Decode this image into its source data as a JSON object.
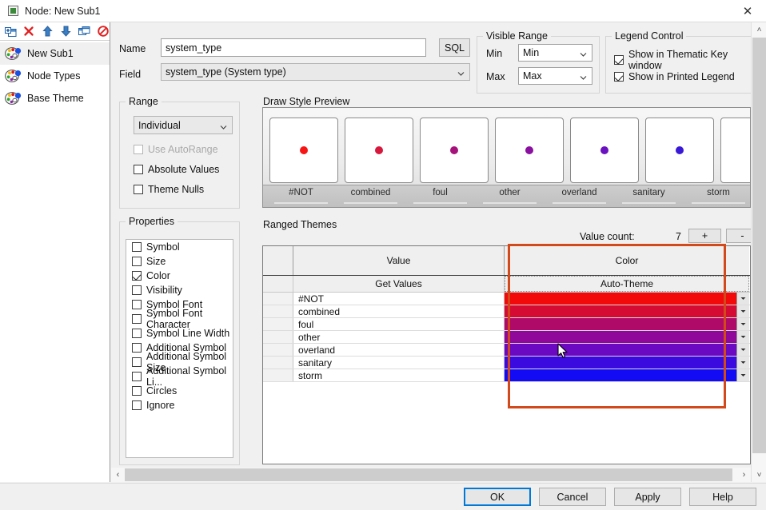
{
  "window": {
    "title": "Node: New Sub1",
    "close_label": "✕",
    "icon": "node-theme-icon"
  },
  "sidebar": {
    "toolbar": [
      {
        "name": "add-sub-theme",
        "icon": "add-window-icon"
      },
      {
        "name": "delete-theme",
        "icon": "red-x-icon"
      },
      {
        "name": "move-up",
        "icon": "arrow-up-icon"
      },
      {
        "name": "move-down",
        "icon": "arrow-down-icon"
      },
      {
        "name": "duplicate-theme",
        "icon": "copy-window-icon"
      },
      {
        "name": "disable-theme",
        "icon": "no-entry-icon"
      }
    ],
    "items": [
      {
        "label": "New Sub1",
        "selected": true
      },
      {
        "label": "Node Types",
        "selected": false
      },
      {
        "label": "Base Theme",
        "selected": false
      }
    ]
  },
  "form": {
    "name_label": "Name",
    "name_value": "system_type",
    "name_placeholder": "",
    "sql_button": "SQL",
    "field_label": "Field",
    "field_value": "system_type (System type)"
  },
  "visible_range": {
    "title": "Visible Range",
    "min_label": "Min",
    "min_value": "Min",
    "max_label": "Max",
    "max_value": "Max"
  },
  "legend_control": {
    "title": "Legend Control",
    "options": [
      {
        "label": "Show in Thematic Key window",
        "checked": true
      },
      {
        "label": "Show in Printed Legend",
        "checked": true
      }
    ]
  },
  "range": {
    "title": "Range",
    "mode_value": "Individual",
    "options": [
      {
        "label": "Use AutoRange",
        "checked": false,
        "disabled": true
      },
      {
        "label": "Absolute Values",
        "checked": false,
        "disabled": false
      },
      {
        "label": "Theme Nulls",
        "checked": false,
        "disabled": false
      }
    ]
  },
  "properties": {
    "title": "Properties",
    "items": [
      {
        "label": "Symbol",
        "checked": false
      },
      {
        "label": "Size",
        "checked": false
      },
      {
        "label": "Color",
        "checked": true
      },
      {
        "label": "Visibility",
        "checked": false
      },
      {
        "label": "Symbol Font",
        "checked": false
      },
      {
        "label": "Symbol Font Character",
        "checked": false
      },
      {
        "label": "Symbol Line Width",
        "checked": false
      },
      {
        "label": "Additional Symbol",
        "checked": false
      },
      {
        "label": "Additional Symbol Size",
        "checked": false
      },
      {
        "label": "Additional Symbol Li...",
        "checked": false
      },
      {
        "label": "Circles",
        "checked": false
      },
      {
        "label": "Ignore",
        "checked": false
      }
    ]
  },
  "draw_style_preview": {
    "title": "Draw Style Preview",
    "cells": [
      {
        "label": "#NOT",
        "dot_color": "#f71414"
      },
      {
        "label": "combined",
        "dot_color": "#d6183c"
      },
      {
        "label": "foul",
        "dot_color": "#a5127a"
      },
      {
        "label": "other",
        "dot_color": "#8a10a0"
      },
      {
        "label": "overland",
        "dot_color": "#6a11c0"
      },
      {
        "label": "sanitary",
        "dot_color": "#3a18d8"
      },
      {
        "label": "storm",
        "dot_color": "#1a1ef5"
      }
    ]
  },
  "ranged_themes": {
    "title": "Ranged Themes",
    "value_count_label": "Value count:",
    "value_count": "7",
    "plus_button": "+",
    "minus_button": "-",
    "headers": {
      "value": "Value",
      "color": "Color"
    },
    "subheaders": {
      "value": "Get Values",
      "color": "Auto-Theme"
    },
    "rows": [
      {
        "value": "#NOT",
        "color": "#f20909"
      },
      {
        "value": "combined",
        "color": "#d60b33"
      },
      {
        "value": "foul",
        "color": "#b00a68"
      },
      {
        "value": "other",
        "color": "#8f089a"
      },
      {
        "value": "overland",
        "color": "#6a08c2"
      },
      {
        "value": "sanitary",
        "color": "#3a0ade"
      },
      {
        "value": "storm",
        "color": "#140bf5"
      }
    ],
    "highlight_color": "#d2491c"
  },
  "footer": {
    "buttons": [
      {
        "label": "OK",
        "default": true
      },
      {
        "label": "Cancel",
        "default": false
      },
      {
        "label": "Apply",
        "default": false
      },
      {
        "label": "Help",
        "default": false
      }
    ]
  },
  "scrollbars": {
    "v_up": "˄",
    "v_down": "˅",
    "h_left": "‹",
    "h_right": "›"
  }
}
